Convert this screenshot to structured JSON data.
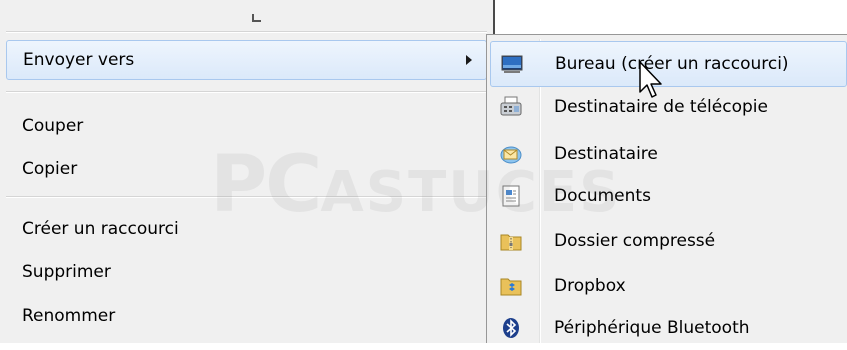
{
  "context_menu": {
    "items": [
      {
        "label": "Envoyer vers"
      },
      {
        "label": "Couper"
      },
      {
        "label": "Copier"
      },
      {
        "label": "Créer un raccourci"
      },
      {
        "label": "Supprimer"
      },
      {
        "label": "Renommer"
      }
    ]
  },
  "submenu": {
    "items": [
      {
        "label": "Bureau (créer un raccourci)",
        "icon": "desktop-icon"
      },
      {
        "label": "Destinataire de télécopie",
        "icon": "fax-icon"
      },
      {
        "label": "Destinataire",
        "icon": "mail-recipient-icon"
      },
      {
        "label": "Documents",
        "icon": "documents-icon"
      },
      {
        "label": "Dossier compressé",
        "icon": "zip-folder-icon"
      },
      {
        "label": "Dropbox",
        "icon": "dropbox-folder-icon"
      },
      {
        "label": "Périphérique Bluetooth",
        "icon": "bluetooth-icon"
      }
    ]
  },
  "watermark": {
    "part1": "PC",
    "part2": "ASTUCES"
  },
  "colors": {
    "highlight_border": "#a9c8ee",
    "highlight_fill": "#dbe9fa",
    "menu_bg": "#f0f0f0"
  }
}
